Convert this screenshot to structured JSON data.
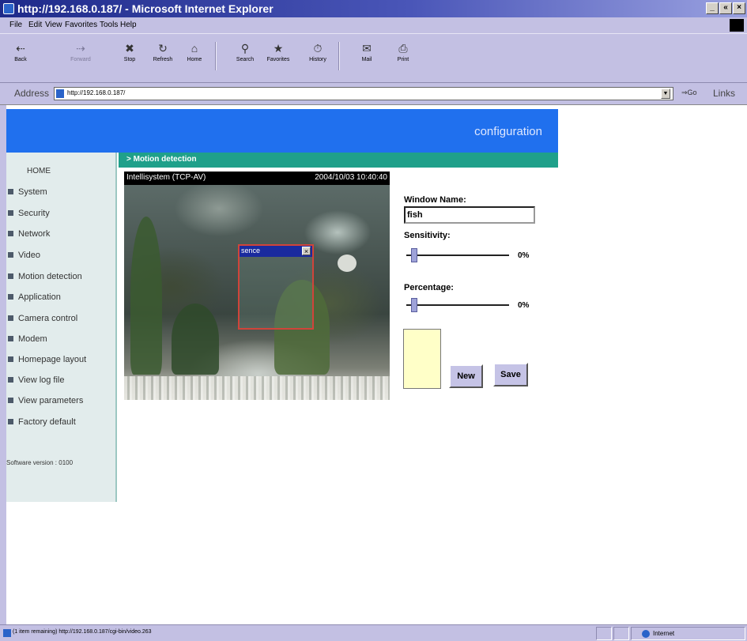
{
  "window": {
    "title": "http://192.168.0.187/ - Microsoft Internet Explorer",
    "controls": [
      "_",
      "«",
      "×"
    ]
  },
  "menubar": {
    "items": [
      "File",
      "Edit",
      "View",
      "Favorites",
      "Tools",
      "Help"
    ]
  },
  "toolbar": {
    "back": "Back",
    "forward": "Forward",
    "stop": "Stop",
    "refresh": "Refresh",
    "home": "Home",
    "search": "Search",
    "favorites": "Favorites",
    "history": "History",
    "mail": "Mail",
    "print": "Print"
  },
  "address": {
    "label": "Address",
    "url": "http://192.168.0.187/",
    "go": "Go",
    "links": "Links"
  },
  "page": {
    "banner": "configuration",
    "section_title": "> Motion detection",
    "sidebar": {
      "home": "HOME",
      "items": [
        "System",
        "Security",
        "Network",
        "Video",
        "Motion detection",
        "Application",
        "Camera control",
        "Modem",
        "Homepage layout",
        "View log file",
        "View parameters",
        "Factory default"
      ],
      "software_version": "Software version : 0100"
    },
    "video": {
      "camera_name": "Intellisystem (TCP-AV)",
      "timestamp": "2004/10/03 10:40:40",
      "motion_window": {
        "name": "sence",
        "close": "×"
      }
    },
    "settings": {
      "window_name_label": "Window Name:",
      "window_name_value": "fish",
      "sensitivity_label": "Sensitivity:",
      "sensitivity_value": "0%",
      "sensitivity_level": 0,
      "percentage_label": "Percentage:",
      "percentage_value": "0%",
      "percentage_level": 0,
      "swatch_color": "#ffffc8",
      "new_button": "New",
      "save_button": "Save"
    }
  },
  "statusbar": {
    "text": "(1 item remaining) http://192.168.0.187/cgi-bin/video.263",
    "zone": "Internet"
  }
}
